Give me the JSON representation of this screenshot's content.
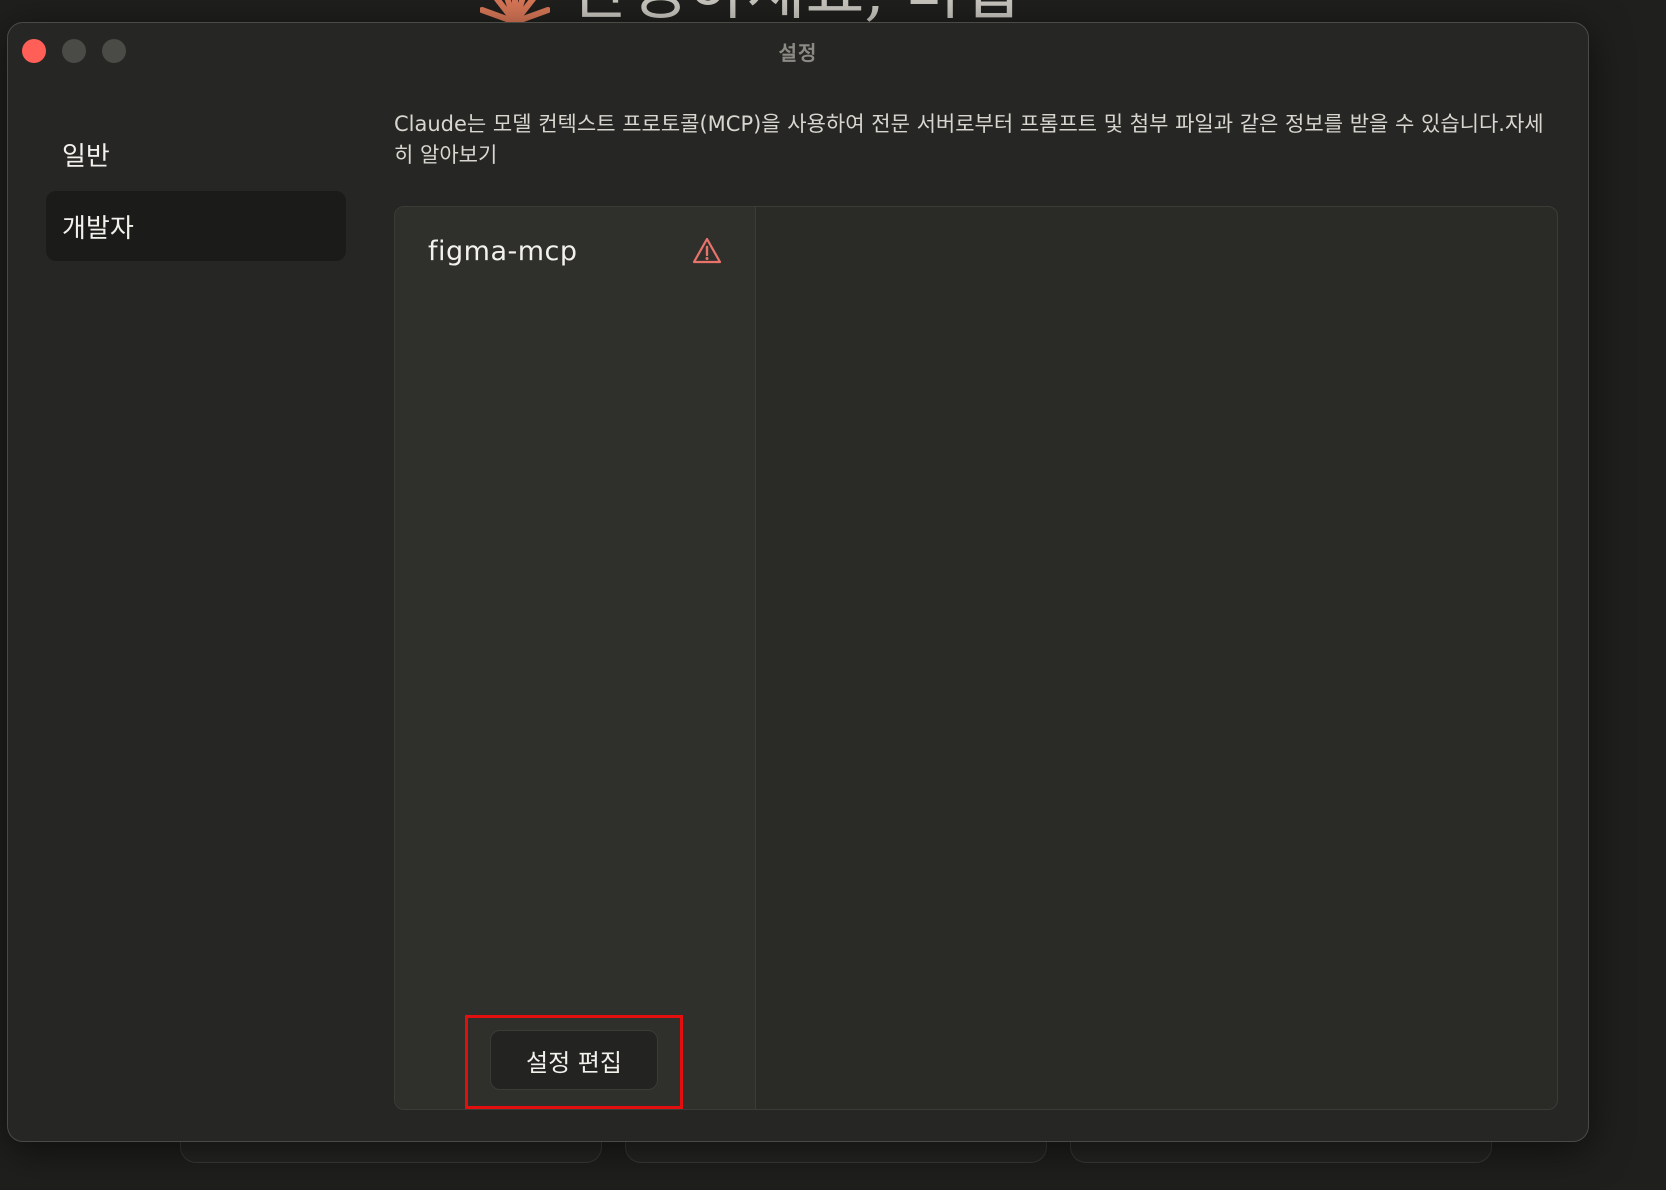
{
  "background": {
    "greeting": "안녕하세요, 바랍",
    "logo_icon": "claude-spark-icon",
    "accent_color": "#d97757"
  },
  "window": {
    "title": "설정",
    "close_color": "#ff5f57"
  },
  "sidebar": {
    "items": [
      {
        "label": "일반",
        "active": false
      },
      {
        "label": "개발자",
        "active": true
      }
    ]
  },
  "developer": {
    "description": "Claude는 모델 컨텍스트 프로토콜(MCP)을 사용하여 전문 서버로부터 프롬프트 및 첨부 파일과 같은 정보를 받을 수 있습니다.",
    "learn_more": "자세히 알아보기",
    "servers": [
      {
        "name": "figma-mcp",
        "status_icon": "warning-icon",
        "status_color": "#e8736a"
      }
    ],
    "edit_button_label": "설정 편집",
    "highlight_color": "#e30f0f"
  }
}
